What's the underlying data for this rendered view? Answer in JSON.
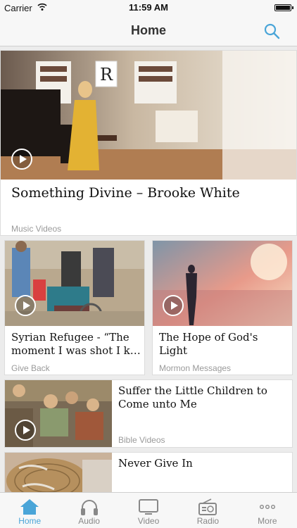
{
  "status": {
    "carrier": "Carrier",
    "time": "11:59 AM"
  },
  "nav": {
    "title": "Home"
  },
  "featured": {
    "title": "Something Divine – Brooke White",
    "category": "Music Videos"
  },
  "grid": [
    {
      "title": "Syrian Refugee - “The moment I was shot I k…",
      "category": "Give Back"
    },
    {
      "title": "The Hope of God's Light",
      "category": "Mormon Messages"
    }
  ],
  "list": [
    {
      "title": "Suffer the Little Children to Come unto Me",
      "category": "Bible Videos"
    },
    {
      "title": "Never Give In",
      "category": ""
    }
  ],
  "tabs": [
    {
      "label": "Home",
      "icon": "home-icon",
      "active": true
    },
    {
      "label": "Audio",
      "icon": "headphones-icon",
      "active": false
    },
    {
      "label": "Video",
      "icon": "tv-icon",
      "active": false
    },
    {
      "label": "Radio",
      "icon": "radio-icon",
      "active": false
    },
    {
      "label": "More",
      "icon": "more-dots-icon",
      "active": false
    }
  ],
  "colors": {
    "accent": "#4aa5d8",
    "inactive": "#888888"
  }
}
